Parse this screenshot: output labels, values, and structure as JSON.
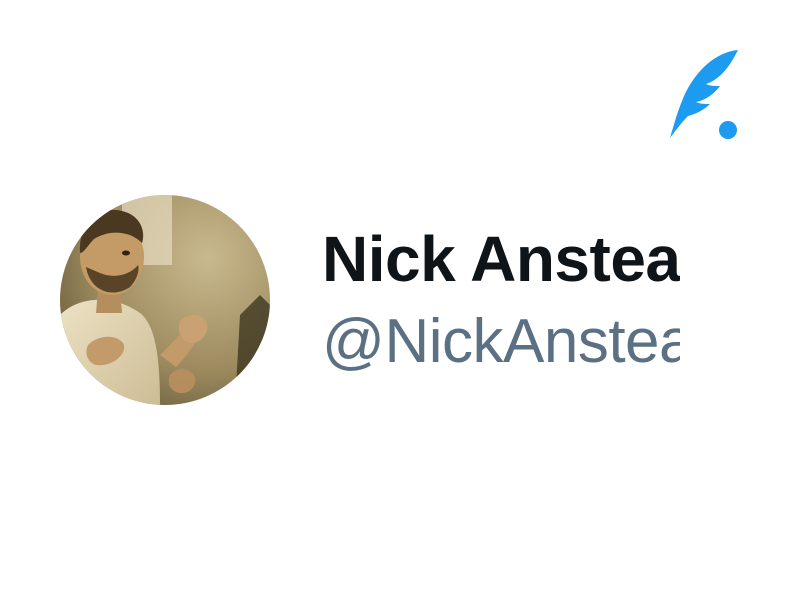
{
  "app": {
    "logo_icon": "quill-feather-icon",
    "accent_color": "#1d9bf0"
  },
  "profile": {
    "avatar_icon": "profile-photo",
    "display_name": "Nick Anstead",
    "handle": "@NickAnstead",
    "name_color": "#0f1419",
    "handle_color": "#5b7083"
  }
}
